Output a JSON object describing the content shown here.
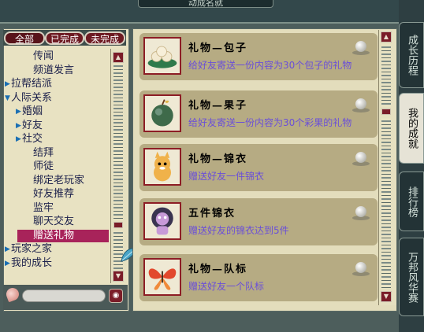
{
  "window": {
    "title": "动成名就"
  },
  "filters": [
    {
      "label": "全部",
      "active": true
    },
    {
      "label": "已完成",
      "active": false
    },
    {
      "label": "未完成",
      "active": false
    }
  ],
  "tree": [
    {
      "label": "传闻",
      "level": 2,
      "arrow": "",
      "selected": false
    },
    {
      "label": "频道发言",
      "level": 2,
      "arrow": "",
      "selected": false
    },
    {
      "label": "拉帮结派",
      "level": 0,
      "arrow": "right",
      "selected": false
    },
    {
      "label": "人际关系",
      "level": 0,
      "arrow": "down",
      "selected": false
    },
    {
      "label": "婚姻",
      "level": 1,
      "arrow": "right",
      "selected": false
    },
    {
      "label": "好友",
      "level": 1,
      "arrow": "right",
      "selected": false
    },
    {
      "label": "社交",
      "level": 1,
      "arrow": "right",
      "selected": false
    },
    {
      "label": "结拜",
      "level": 2,
      "arrow": "",
      "selected": false
    },
    {
      "label": "师徒",
      "level": 2,
      "arrow": "",
      "selected": false
    },
    {
      "label": "绑定老玩家",
      "level": 2,
      "arrow": "",
      "selected": false
    },
    {
      "label": "好友推荐",
      "level": 2,
      "arrow": "",
      "selected": false
    },
    {
      "label": "监牢",
      "level": 2,
      "arrow": "",
      "selected": false
    },
    {
      "label": "聊天交友",
      "level": 2,
      "arrow": "",
      "selected": false
    },
    {
      "label": "赠送礼物",
      "level": 2,
      "arrow": "",
      "selected": true
    },
    {
      "label": "玩家之家",
      "level": 0,
      "arrow": "right",
      "selected": false
    },
    {
      "label": "我的成长",
      "level": 0,
      "arrow": "right",
      "selected": false
    }
  ],
  "search": {
    "value": ""
  },
  "achievements": [
    {
      "title": "礼物—包子",
      "desc": "给好友寄送一份内容为30个包子的礼物",
      "icon": "steamed-bun-icon"
    },
    {
      "title": "礼物—果子",
      "desc": "给好友寄送一份内容为30个彩果的礼物",
      "icon": "fruit-icon"
    },
    {
      "title": "礼物—锦衣",
      "desc": "赠送好友一件锦衣",
      "icon": "cat-costume-icon"
    },
    {
      "title": "五件锦衣",
      "desc": "赠送好友的锦衣达到5件",
      "icon": "lion-costume-icon"
    },
    {
      "title": "礼物—队标",
      "desc": "赠送好友一个队标",
      "icon": "butterfly-icon"
    }
  ],
  "tabs": [
    {
      "label": "成长历程",
      "active": false
    },
    {
      "label": "我的成就",
      "active": true
    },
    {
      "label": "排行榜",
      "active": false
    },
    {
      "label": "万邦风华赛",
      "active": false
    }
  ],
  "colors": {
    "accent": "#7a1c28",
    "selection": "#a8235a",
    "desc_text": "#6a4fd8",
    "card": "#b6ab83"
  }
}
